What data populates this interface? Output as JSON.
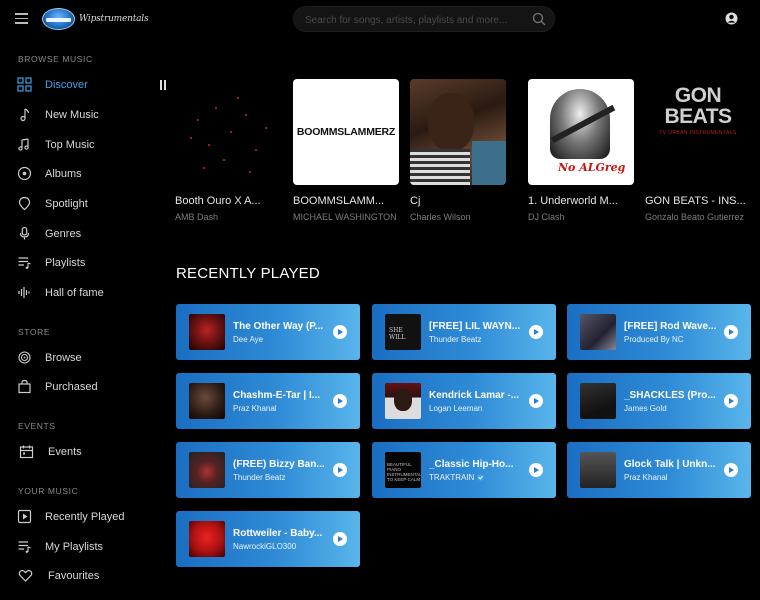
{
  "header": {
    "logo_text": "Wipstrumentals",
    "search_placeholder": "Search for songs, artists, playlists and more..."
  },
  "sidebar": {
    "browse_title": "BROWSE MUSIC",
    "browse_items": [
      {
        "label": "Discover",
        "icon": "grid-icon",
        "active": true
      },
      {
        "label": "New Music",
        "icon": "music-note-icon"
      },
      {
        "label": "Top Music",
        "icon": "music-notes-icon"
      },
      {
        "label": "Albums",
        "icon": "disc-icon"
      },
      {
        "label": "Spotlight",
        "icon": "spotlight-icon"
      },
      {
        "label": "Genres",
        "icon": "microphone-icon"
      },
      {
        "label": "Playlists",
        "icon": "playlist-icon"
      },
      {
        "label": "Hall of fame",
        "icon": "waveform-icon"
      }
    ],
    "store_title": "STORE",
    "store_items": [
      {
        "label": "Browse",
        "icon": "target-icon"
      },
      {
        "label": "Purchased",
        "icon": "bag-icon"
      }
    ],
    "events_title": "EVENTS",
    "events_items": [
      {
        "label": "Events",
        "icon": "calendar-icon"
      }
    ],
    "your_music_title": "YOUR MUSIC",
    "your_music_items": [
      {
        "label": "Recently Played",
        "icon": "play-square-icon"
      },
      {
        "label": "My Playlists",
        "icon": "my-playlist-icon"
      },
      {
        "label": "Favourites",
        "icon": "heart-icon"
      }
    ]
  },
  "carousel": {
    "cards": [
      {
        "title": "Booth Ouro X A...",
        "artist": "AMB Dash"
      },
      {
        "title": "BOOMMSLAMM...",
        "artist": "MICHAEL WASHINGTON",
        "art_text": "BOOMMSLAMMERZ"
      },
      {
        "title": "Cj",
        "artist": "Charles Wilson"
      },
      {
        "title": "1. Underworld M...",
        "artist": "DJ Clash",
        "art_text": "No ALGreg"
      },
      {
        "title": "GON BEATS - INS...",
        "artist": "Gonzalo Beato Gutierrez",
        "art_text": "GON BEATS",
        "art_sub": "TV URBAN INSTRUMENTALS"
      }
    ]
  },
  "recently_played": {
    "heading": "RECENTLY PLAYED",
    "tiles": [
      {
        "title": "The Other Way (P...",
        "artist": "Dee Aye"
      },
      {
        "title": "[FREE] LIL WAYN...",
        "artist": "Thunder Beatz",
        "thumb_text": "SHE WILL"
      },
      {
        "title": "[FREE] Rod Wave...",
        "artist": "Produced By NC"
      },
      {
        "title": "Chashm-E-Tar | I...",
        "artist": "Praz Khanal"
      },
      {
        "title": "Kendrick Lamar -...",
        "artist": "Logan Leeman"
      },
      {
        "title": "_SHACKLES (Pro...",
        "artist": "James Gold"
      },
      {
        "title": "(FREE) Bizzy Ban...",
        "artist": "Thunder Beatz"
      },
      {
        "title": "_Classic Hip-Ho...",
        "artist": "TRAKTRAIN",
        "verified": true,
        "thumb_text": "BEAUTIFUL PIANO INSTRUMENTALS TO KEEP CALM"
      },
      {
        "title": "Glock Talk | Unkn...",
        "artist": "Praz Khanal"
      },
      {
        "title": "Rottweiler - Baby...",
        "artist": "NawrockiGLO300"
      }
    ]
  },
  "colors": {
    "accent": "#3fa0e6",
    "tile_gradient_start": "#1a6ec2",
    "tile_gradient_end": "#59b5ea",
    "background": "#000000"
  }
}
